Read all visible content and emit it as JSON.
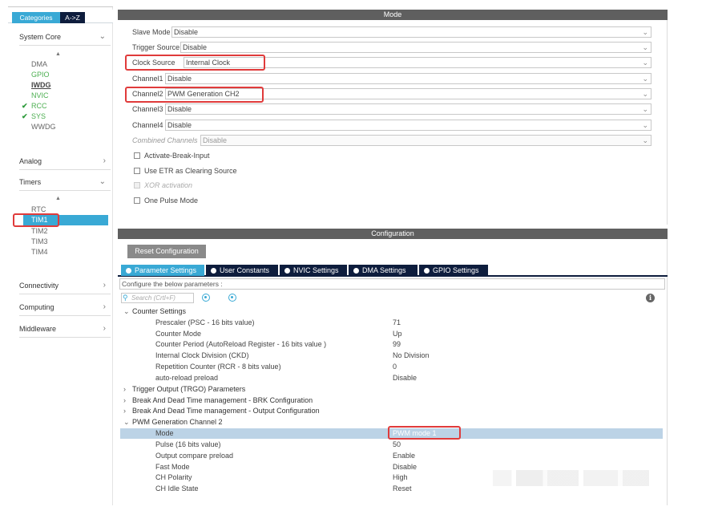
{
  "sidebar": {
    "tabs": {
      "categories": "Categories",
      "az": "A->Z"
    },
    "system_core": {
      "label": "System Core",
      "items": [
        {
          "label": "DMA",
          "style": "normal"
        },
        {
          "label": "GPIO",
          "style": "green"
        },
        {
          "label": "IWDG",
          "style": "bold"
        },
        {
          "label": "NVIC",
          "style": "green"
        },
        {
          "label": "RCC",
          "style": "check"
        },
        {
          "label": "SYS",
          "style": "check"
        },
        {
          "label": "WWDG",
          "style": "normal"
        }
      ]
    },
    "analog": {
      "label": "Analog"
    },
    "timers": {
      "label": "Timers",
      "items": [
        "RTC",
        "TIM1",
        "TIM2",
        "TIM3",
        "TIM4"
      ],
      "selected": "TIM1"
    },
    "connectivity": {
      "label": "Connectivity"
    },
    "computing": {
      "label": "Computing"
    },
    "middleware": {
      "label": "Middleware"
    }
  },
  "mode": {
    "header": "Mode",
    "rows": [
      {
        "label": "Slave Mode",
        "value": "Disable"
      },
      {
        "label": "Trigger Source",
        "value": "Disable"
      },
      {
        "label": "Clock Source",
        "value": "Internal Clock"
      },
      {
        "label": "Channel1",
        "value": "Disable"
      },
      {
        "label": "Channel2",
        "value": "PWM Generation CH2"
      },
      {
        "label": "Channel3",
        "value": "Disable"
      },
      {
        "label": "Channel4",
        "value": "Disable"
      },
      {
        "label": "Combined Channels",
        "value": "Disable"
      }
    ],
    "checkboxes": [
      {
        "label": "Activate-Break-Input",
        "disabled": false
      },
      {
        "label": "Use ETR as Clearing Source",
        "disabled": false
      },
      {
        "label": "XOR activation",
        "disabled": true
      },
      {
        "label": "One Pulse Mode",
        "disabled": false
      }
    ]
  },
  "configuration": {
    "header": "Configuration",
    "reset_label": "Reset Configuration",
    "tabs": [
      "Parameter Settings",
      "User Constants",
      "NVIC Settings",
      "DMA Settings",
      "GPIO Settings"
    ],
    "hint": "Configure the below parameters :",
    "search_placeholder": "Search (Crtl+F)",
    "info_glyph": "i",
    "groups": {
      "counter": "Counter Settings",
      "trgo": "Trigger Output (TRGO) Parameters",
      "brk": "Break And Dead Time management - BRK Configuration",
      "output": "Break And Dead Time management - Output Configuration",
      "pwm": "PWM Generation Channel 2"
    },
    "counter_params": [
      {
        "name": "Prescaler (PSC - 16 bits value)",
        "value": "71"
      },
      {
        "name": "Counter Mode",
        "value": "Up"
      },
      {
        "name": "Counter Period (AutoReload Register - 16 bits value )",
        "value": "99"
      },
      {
        "name": "Internal Clock Division (CKD)",
        "value": "No Division"
      },
      {
        "name": "Repetition Counter (RCR - 8 bits value)",
        "value": "0"
      },
      {
        "name": "auto-reload preload",
        "value": "Disable"
      }
    ],
    "pwm_params": [
      {
        "name": "Mode",
        "value": "PWM mode 1"
      },
      {
        "name": "Pulse (16 bits value)",
        "value": "50"
      },
      {
        "name": "Output compare preload",
        "value": "Enable"
      },
      {
        "name": "Fast Mode",
        "value": "Disable"
      },
      {
        "name": "CH Polarity",
        "value": "High"
      },
      {
        "name": "CH Idle State",
        "value": "Reset"
      }
    ]
  },
  "colors": {
    "accent": "#39a9d5",
    "dark_tab": "#0e1d3d",
    "header": "#5f5f5f",
    "highlight": "#e03b3b",
    "selected_row": "#bcd3e6"
  }
}
